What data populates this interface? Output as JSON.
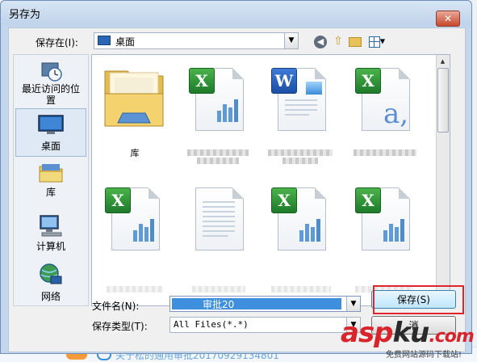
{
  "dialog": {
    "title": "另存为",
    "close_glyph": "✕"
  },
  "toolbar": {
    "save_in_label": "保存在(I):",
    "save_in_value": "桌面",
    "back_glyph": "◀",
    "up_glyph": "⇧",
    "dropdown_glyph": "▼"
  },
  "places": [
    {
      "label": "最近访问的位\n置",
      "icon": "clock-icon"
    },
    {
      "label": "桌面",
      "icon": "desktop-icon"
    },
    {
      "label": "库",
      "icon": "library-icon"
    },
    {
      "label": "计算机",
      "icon": "computer-icon"
    },
    {
      "label": "网络",
      "icon": "network-icon"
    }
  ],
  "files": [
    {
      "name": "库",
      "type": "library-folder"
    },
    {
      "name": "",
      "type": "excel"
    },
    {
      "name": "",
      "type": "word"
    },
    {
      "name": "",
      "type": "excel-text"
    },
    {
      "name": "",
      "type": "excel"
    },
    {
      "name": "",
      "type": "text"
    },
    {
      "name": "",
      "type": "excel"
    },
    {
      "name": "",
      "type": "excel"
    }
  ],
  "form": {
    "filename_label": "文件名(N):",
    "filename_value": "审批20",
    "filetype_label": "保存类型(T):",
    "filetype_value": "All Files(*.*)"
  },
  "buttons": {
    "save_label": "保存(S)",
    "cancel_label": "消"
  },
  "background": {
    "bottom_text": "关于松的通用审批20170929134801"
  },
  "watermark": {
    "brand_a": "asp",
    "brand_b": "ku",
    "brand_c": ".com",
    "tagline": "免费网站源码下载站!"
  },
  "colors": {
    "highlight": "#e0262d",
    "selection": "#3f8fdf"
  }
}
